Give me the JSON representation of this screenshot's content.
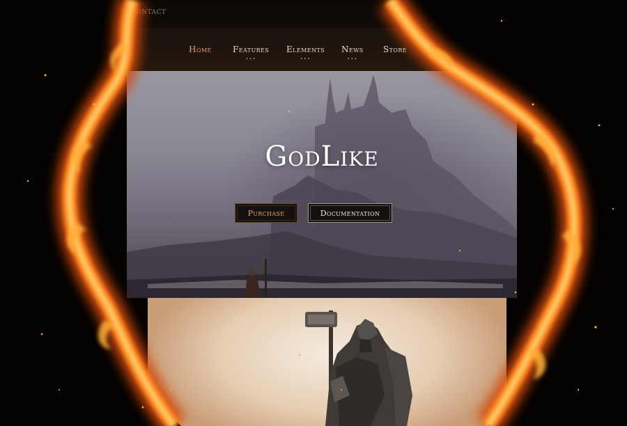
{
  "topbar": {
    "contact_label": "Contact"
  },
  "nav": {
    "items": [
      {
        "label": "Home",
        "active": true,
        "has_submenu": false
      },
      {
        "label": "Features",
        "active": false,
        "has_submenu": true
      },
      {
        "label": "Elements",
        "active": false,
        "has_submenu": true
      },
      {
        "label": "News",
        "active": false,
        "has_submenu": true
      },
      {
        "label": "Store",
        "active": false,
        "has_submenu": false
      }
    ],
    "submenu_indicator": "•••"
  },
  "hero": {
    "title": "GodLike",
    "purchase_label": "Purchase",
    "documentation_label": "Documentation"
  },
  "theme": {
    "accent": "#e8a05a",
    "fire_core": "#ffb531",
    "fire_outer": "#d34a0a",
    "background": "#050302"
  }
}
